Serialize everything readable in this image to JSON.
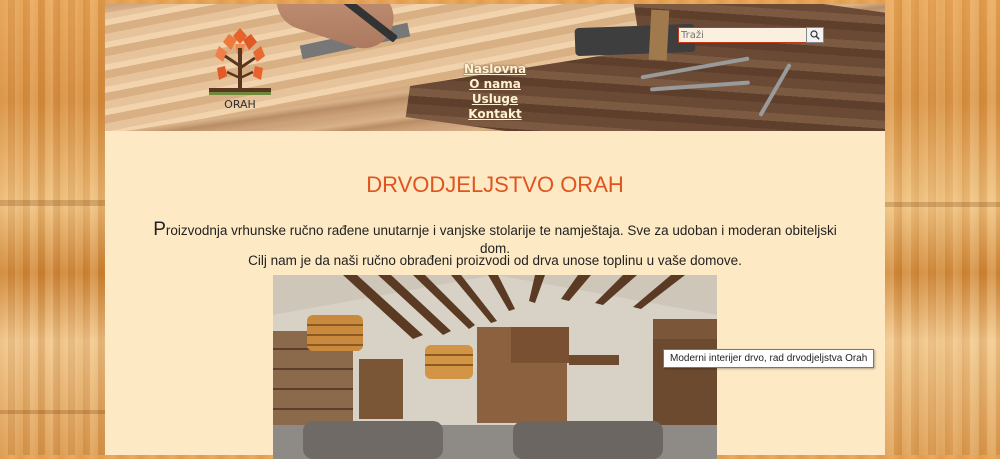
{
  "logo": {
    "text": "ORAH"
  },
  "search": {
    "placeholder": "Traži",
    "value": ""
  },
  "nav": {
    "items": [
      "Naslovna",
      "O nama",
      "Usluge",
      "Kontakt"
    ]
  },
  "main": {
    "title": "DRVODJELJSTVO ORAH",
    "intro_first_letter": "P",
    "intro_rest": "roizvodnja vrhunske ručno rađene unutarnje i vanjske stolarije te namještaja. Sve za udoban i moderan obiteljski dom.",
    "goal": "Cilj nam je da naši ručno obrađeni proizvodi od drva unose toplinu u vaše domove.",
    "image_tooltip": "Moderni interijer drvo, rad drvodjeljstva Orah"
  },
  "colors": {
    "accent": "#e0541e",
    "page_bg": "#fde9c4",
    "nav_text": "#fff3d6"
  },
  "icons": {
    "search": "magnifier-icon"
  }
}
